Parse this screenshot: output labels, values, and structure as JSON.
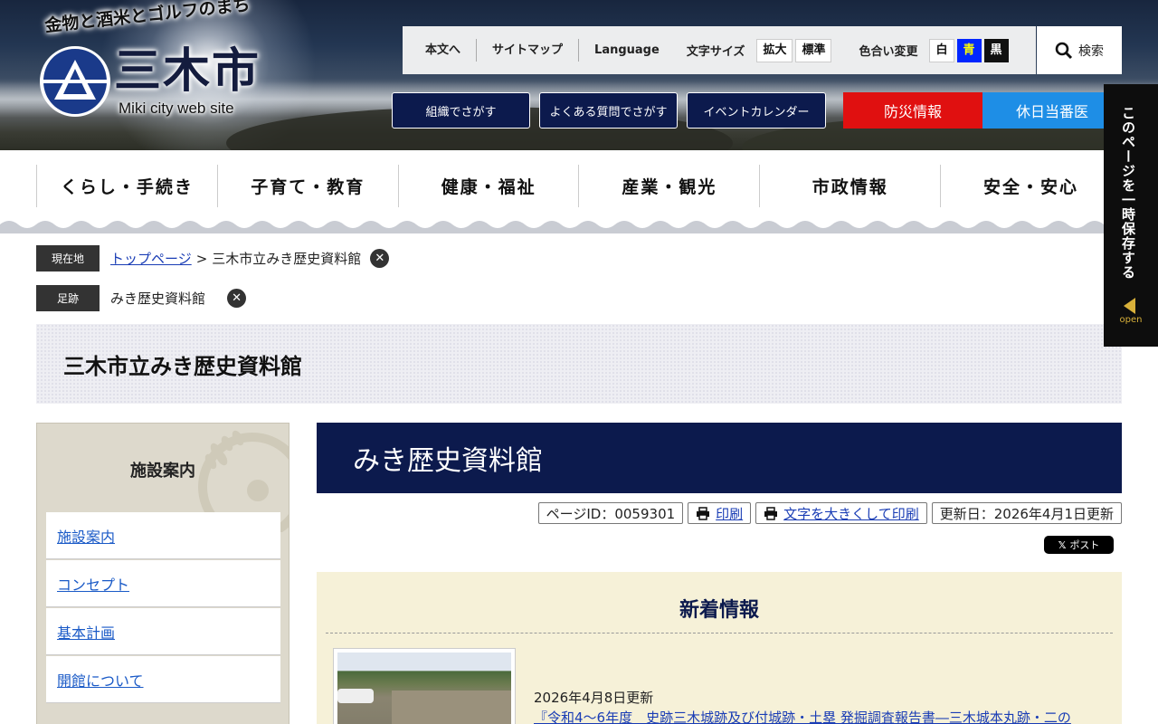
{
  "header": {
    "tagline": "金物と酒米とゴルフのまち",
    "logo_name": "三木市",
    "logo_en": "Miki city web site"
  },
  "toolbar": {
    "links": [
      "本文へ",
      "サイトマップ",
      "Language"
    ],
    "font_size_label": "文字サイズ",
    "font_size_options": [
      "拡大",
      "標準"
    ],
    "color_label": "色合い変更",
    "color_options": [
      "白",
      "青",
      "黒"
    ],
    "search_label": "検索"
  },
  "quicklinks": [
    "組織でさがす",
    "よくある質問でさがす",
    "イベントカレンダー"
  ],
  "emergency": {
    "bousai": "防災情報",
    "kyujitsu": "休日当番医"
  },
  "global_nav": [
    "くらし・手続き",
    "子育て・教育",
    "健康・福祉",
    "産業・観光",
    "市政情報",
    "安全・安心"
  ],
  "breadcrumb": {
    "current_label": "現在地",
    "home": "トップページ",
    "sep": ">",
    "current": "三木市立みき歴史資料館",
    "history_label": "足跡",
    "history_item": "みき歴史資料館"
  },
  "page_title": "三木市立みき歴史資料館",
  "sidebar": {
    "title": "施設案内",
    "items": [
      "施設案内",
      "コンセプト",
      "基本計画",
      "開館について"
    ]
  },
  "main": {
    "heading": "みき歴史資料館",
    "page_id": "ページID：0059301",
    "print": "印刷",
    "print_large": "文字を大きくして印刷",
    "updated": "更新日：2026年4月1日更新",
    "xpost": "ポスト"
  },
  "news": {
    "title": "新着情報",
    "items": [
      {
        "date": "2026年4月8日更新",
        "title": "『令和4～6年度　史跡三木城跡及び付城跡・土塁 発掘調査報告書―三木城本丸跡・二の"
      }
    ]
  },
  "side_tab": {
    "text": "このページを一時保存する",
    "open": "open"
  },
  "colors": {
    "navy": "#0c1a4d",
    "bousai_red": "#e01010",
    "kyujitsu_blue": "#1e8ee6",
    "news_bg": "#f6f1d8",
    "sidebar_bg": "#ddd9cc",
    "link": "#1a3db5"
  }
}
